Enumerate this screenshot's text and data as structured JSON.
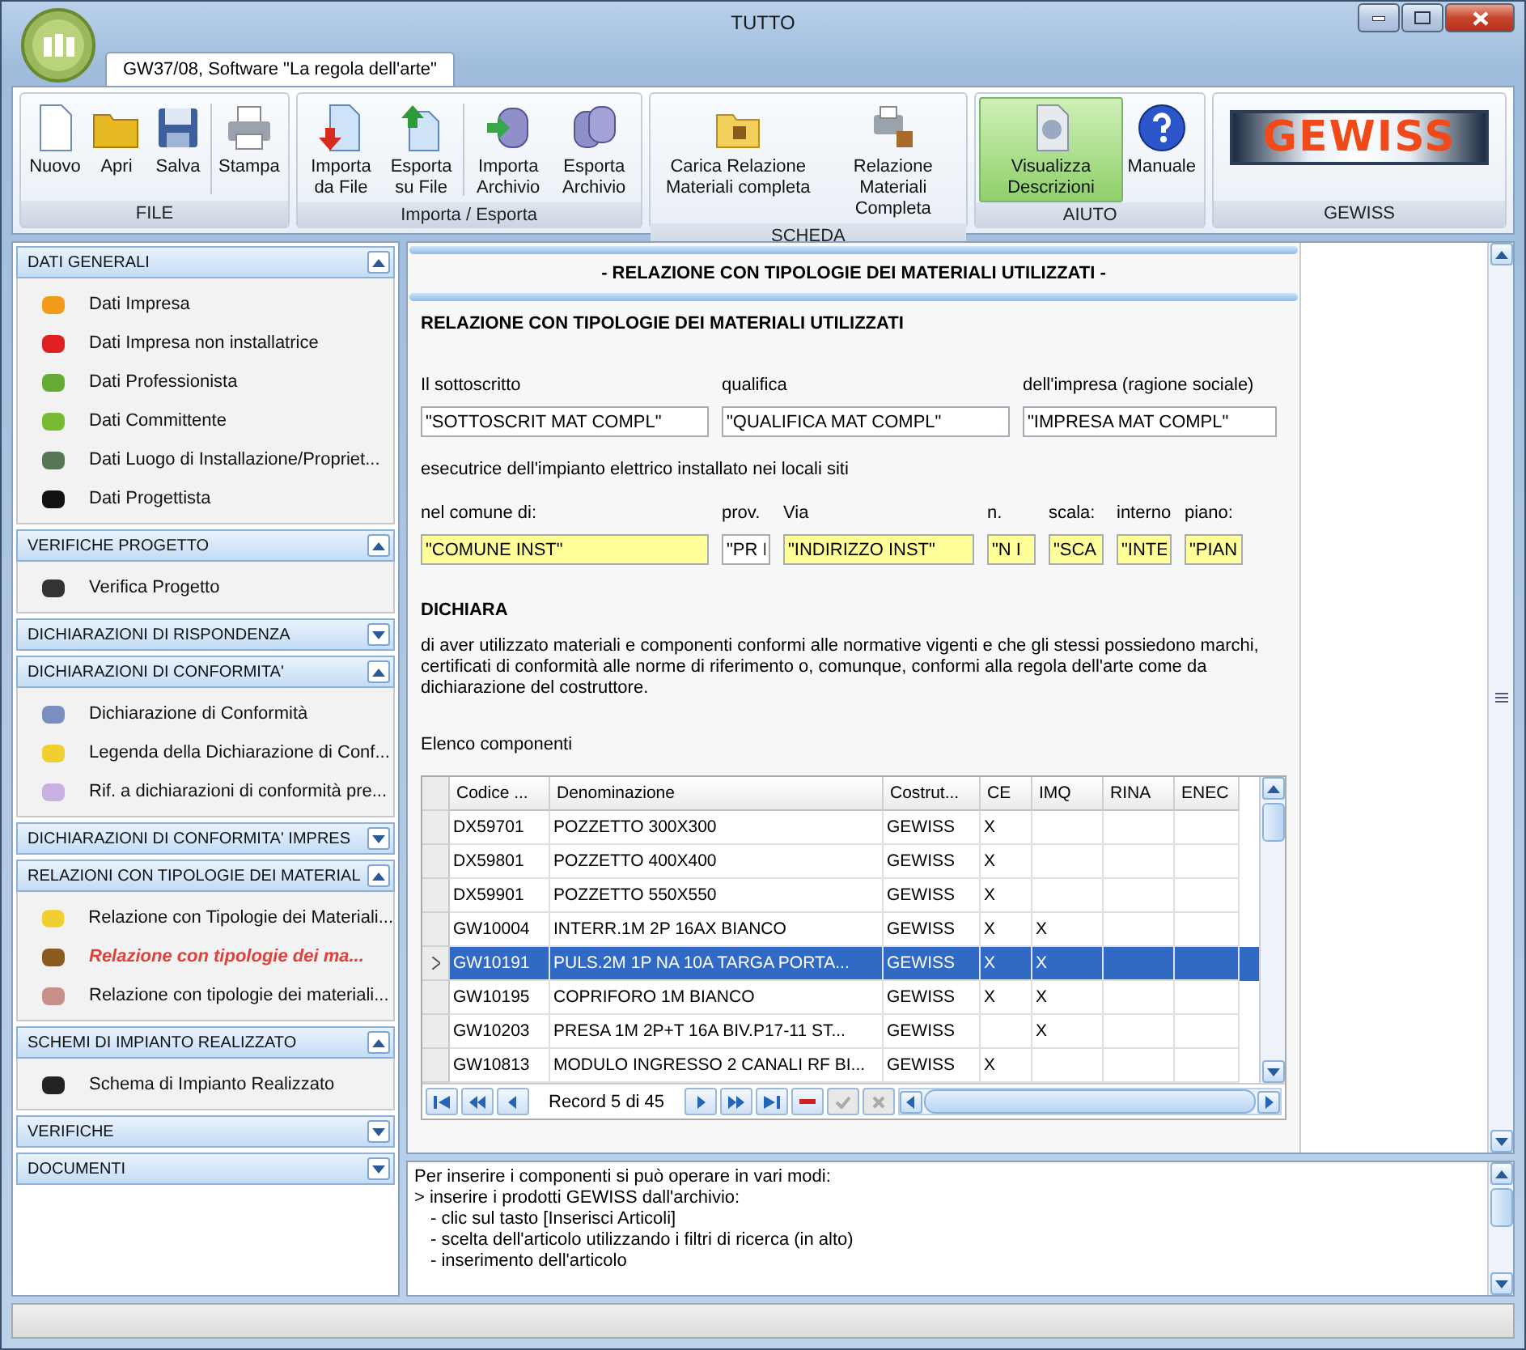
{
  "window": {
    "title": "TUTTO"
  },
  "tab": {
    "label": "GW37/08, Software \"La regola dell'arte\"",
    "selected": true
  },
  "ribbon": [
    {
      "label": "FILE",
      "buttons": [
        {
          "label": "Nuovo",
          "kind": "new",
          "selected": false
        },
        {
          "label": "Apri",
          "kind": "open",
          "selected": false
        },
        {
          "label": "Salva",
          "kind": "save",
          "selected": false
        },
        {
          "label": "Stampa",
          "kind": "print",
          "selected": false
        }
      ]
    },
    {
      "label": "Importa / Esporta",
      "buttons": [
        {
          "label": "Importa da File",
          "kind": "import-file",
          "selected": false
        },
        {
          "label": "Esporta su File",
          "kind": "export-file",
          "selected": false
        },
        {
          "label": "Importa Archivio",
          "kind": "import-db",
          "selected": false
        },
        {
          "label": "Esporta Archivio",
          "kind": "export-db",
          "selected": false
        }
      ]
    },
    {
      "label": "SCHEDA",
      "buttons": [
        {
          "label": "Carica Relazione Materiali completa",
          "kind": "folder-box",
          "selected": false
        },
        {
          "label": "Relazione Materiali Completa",
          "kind": "print-box",
          "selected": false
        }
      ]
    },
    {
      "label": "AIUTO",
      "buttons": [
        {
          "label": "Visualizza Descrizioni",
          "kind": "doc-help",
          "selected": true
        },
        {
          "label": "Manuale",
          "kind": "help",
          "selected": false
        }
      ]
    },
    {
      "label": "GEWISS",
      "logo": "GEWISS"
    }
  ],
  "sidebar": [
    {
      "title": "DATI GENERALI",
      "expanded": true,
      "items": [
        {
          "label": "Dati Impresa",
          "selected": false
        },
        {
          "label": "Dati Impresa non installatrice",
          "selected": false
        },
        {
          "label": "Dati Professionista",
          "selected": false
        },
        {
          "label": "Dati Committente",
          "selected": false
        },
        {
          "label": "Dati Luogo di Installazione/Propriet...",
          "selected": false
        },
        {
          "label": "Dati Progettista",
          "selected": false
        }
      ]
    },
    {
      "title": "VERIFICHE PROGETTO",
      "expanded": true,
      "items": [
        {
          "label": "Verifica Progetto",
          "selected": false
        }
      ]
    },
    {
      "title": "DICHIARAZIONI DI RISPONDENZA",
      "expanded": false
    },
    {
      "title": "DICHIARAZIONI DI CONFORMITA'",
      "expanded": true,
      "items": [
        {
          "label": "Dichiarazione di Conformità",
          "selected": false
        },
        {
          "label": "Legenda della Dichiarazione di Conf...",
          "selected": false
        },
        {
          "label": "Rif. a dichiarazioni di conformità pre...",
          "selected": false
        }
      ]
    },
    {
      "title": "DICHIARAZIONI DI CONFORMITA' IMPRES",
      "expanded": false
    },
    {
      "title": "RELAZIONI CON TIPOLOGIE DEI MATERIAL",
      "expanded": true,
      "items": [
        {
          "label": "Relazione con Tipologie dei Materiali...",
          "selected": false
        },
        {
          "label": "Relazione con tipologie dei ma...",
          "selected": true
        },
        {
          "label": "Relazione con tipologie dei materiali...",
          "selected": false
        }
      ]
    },
    {
      "title": "SCHEMI DI IMPIANTO REALIZZATO",
      "expanded": true,
      "items": [
        {
          "label": "Schema di Impianto Realizzato",
          "selected": false
        }
      ]
    },
    {
      "title": "VERIFICHE",
      "expanded": false
    },
    {
      "title": "DOCUMENTI",
      "expanded": false
    }
  ],
  "content": {
    "banner": "- RELAZIONE CON TIPOLOGIE DEI MATERIALI UTILIZZATI -",
    "heading": "RELAZIONE CON TIPOLOGIE DEI MATERIALI UTILIZZATI",
    "field_rows": [
      [
        {
          "label": "Il sottoscritto",
          "value": "\"SOTTOSCRIT MAT COMPL\"",
          "highlighted": false
        },
        {
          "label": "qualifica",
          "value": "\"QUALIFICA MAT COMPL\"",
          "highlighted": false
        },
        {
          "label": "dell'impresa (ragione sociale)",
          "value": "\"IMPRESA MAT COMPL\"",
          "highlighted": false
        }
      ],
      [
        {
          "label": "nel comune di:",
          "value": "\"COMUNE INST\"",
          "highlighted": true
        },
        {
          "label": "prov.",
          "value": "\"PR I",
          "highlighted": false
        },
        {
          "label": "Via",
          "value": "\"INDIRIZZO INST\"",
          "highlighted": true
        },
        {
          "label": "n.",
          "value": "\"N I",
          "highlighted": true
        },
        {
          "label": "scala:",
          "value": "\"SCA",
          "highlighted": true
        },
        {
          "label": "interno",
          "value": "\"INTE",
          "highlighted": true
        },
        {
          "label": "piano:",
          "value": "\"PIAN",
          "highlighted": true
        }
      ]
    ],
    "between": "esecutrice dell'impianto elettrico installato nei locali siti",
    "declare_heading": "DICHIARA",
    "declare_text": "di aver utilizzato materiali e componenti conformi alle normative vigenti e che gli stessi possiedono marchi, certificati di conformità alle norme di riferimento o, comunque, conformi alla regola dell'arte come da dichiarazione del costruttore.",
    "list_label": "Elenco componenti",
    "table": {
      "columns": [
        "Codice ...",
        "Denominazione",
        "Costrut...",
        "CE",
        "IMQ",
        "RINA",
        "ENEC"
      ],
      "rows": [
        {
          "cells": [
            "DX59701",
            "POZZETTO 300X300",
            "GEWISS",
            "X",
            "",
            "",
            ""
          ],
          "selected": false
        },
        {
          "cells": [
            "DX59801",
            "POZZETTO 400X400",
            "GEWISS",
            "X",
            "",
            "",
            ""
          ],
          "selected": false
        },
        {
          "cells": [
            "DX59901",
            "POZZETTO 550X550",
            "GEWISS",
            "X",
            "",
            "",
            ""
          ],
          "selected": false
        },
        {
          "cells": [
            "GW10004",
            "INTERR.1M 2P 16AX BIANCO",
            "GEWISS",
            "X",
            "X",
            "",
            ""
          ],
          "selected": false
        },
        {
          "cells": [
            "GW10191",
            "PULS.2M 1P NA 10A TARGA PORTA...",
            "GEWISS",
            "X",
            "X",
            "",
            ""
          ],
          "selected": true
        },
        {
          "cells": [
            "GW10195",
            "COPRIFORO 1M  BIANCO",
            "GEWISS",
            "X",
            "X",
            "",
            ""
          ],
          "selected": false
        },
        {
          "cells": [
            "GW10203",
            "PRESA 1M 2P+T 16A BIV.P17-11 ST...",
            "GEWISS",
            "",
            "X",
            "",
            ""
          ],
          "selected": false
        },
        {
          "cells": [
            "GW10813",
            "MODULO INGRESSO 2 CANALI RF BI...",
            "GEWISS",
            "X",
            "",
            "",
            ""
          ],
          "selected": false
        }
      ],
      "navigator": "Record 5 di 45"
    }
  },
  "help": {
    "lines": [
      {
        "text": "Per inserire i componenti si può operare in vari modi:"
      },
      {
        "text": "> inserire i prodotti GEWISS dall'archivio:",
        "children": [
          {
            "text": "- clic sul tasto [Inserisci Articoli]"
          },
          {
            "text": "- scelta dell'articolo utilizzando i filtri di ricerca (in alto)"
          },
          {
            "text": "- inserimento dell'articolo"
          }
        ]
      }
    ]
  }
}
